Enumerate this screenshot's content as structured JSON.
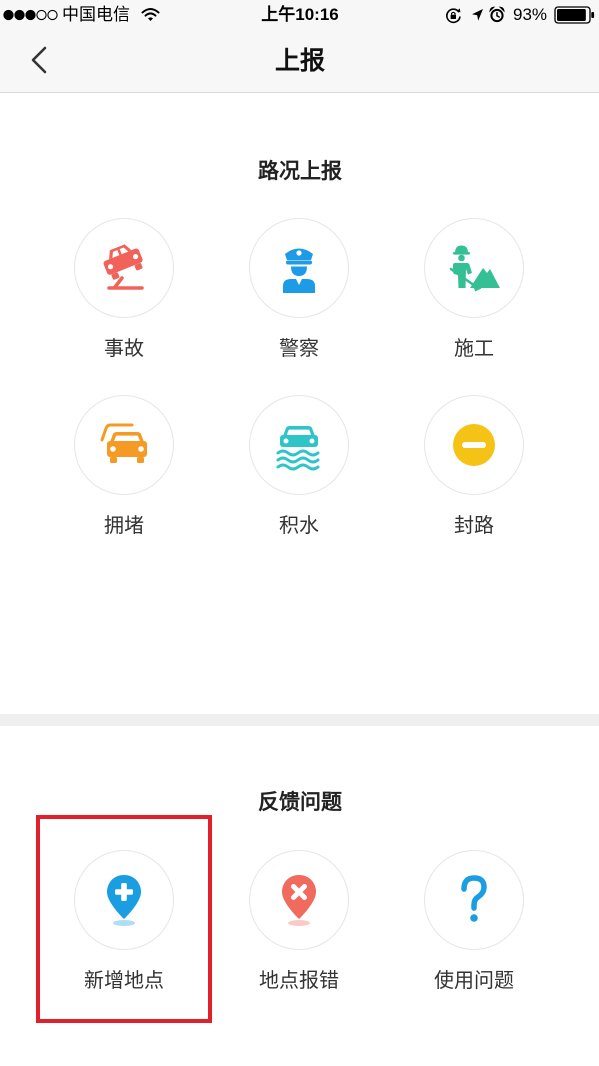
{
  "status_bar": {
    "signal_strength": 3,
    "signal_max": 5,
    "carrier": "中国电信",
    "time": "上午10:16",
    "battery_text": "93%",
    "battery_level": 0.93,
    "icons": [
      "wifi-icon",
      "orientation-lock-icon",
      "location-arrow-icon",
      "alarm-icon",
      "battery-icon"
    ]
  },
  "nav": {
    "title": "上报",
    "back_icon": "chevron-left-icon"
  },
  "road_report": {
    "title": "路况上报",
    "items": [
      {
        "label": "事故",
        "icon": "accident-icon",
        "color": "#f0625a"
      },
      {
        "label": "警察",
        "icon": "police-icon",
        "color": "#1e9be6"
      },
      {
        "label": "施工",
        "icon": "construction-icon",
        "color": "#35bf95"
      },
      {
        "label": "拥堵",
        "icon": "congestion-icon",
        "color": "#f59b25"
      },
      {
        "label": "积水",
        "icon": "flooding-icon",
        "color": "#2ec4c8"
      },
      {
        "label": "封路",
        "icon": "road-closed-icon",
        "color": "#f5c315"
      }
    ]
  },
  "feedback": {
    "title": "反馈问题",
    "items": [
      {
        "label": "新增地点",
        "icon": "add-location-icon",
        "color": "#1b9de2"
      },
      {
        "label": "地点报错",
        "icon": "location-error-icon",
        "color": "#f06a5d"
      },
      {
        "label": "使用问题",
        "icon": "question-icon",
        "color": "#1b9de2"
      }
    ]
  },
  "colors": {
    "bar_background": "#f7f7f7",
    "divider": "#efefef",
    "highlight": "#e1202b",
    "text": "#333333"
  }
}
